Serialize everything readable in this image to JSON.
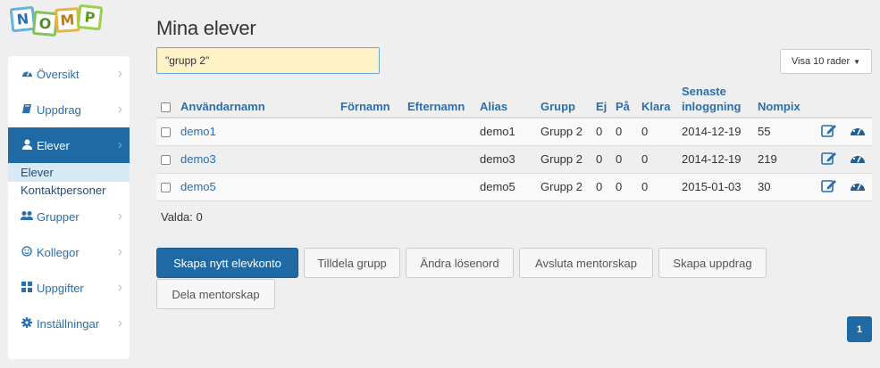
{
  "logo": {
    "letters": [
      "N",
      "O",
      "M",
      "P"
    ]
  },
  "sidebar": {
    "items": [
      {
        "label": "Översikt",
        "icon": "dashboard-icon"
      },
      {
        "label": "Uppdrag",
        "icon": "book-icon"
      },
      {
        "label": "Elever",
        "icon": "user-icon",
        "active": true
      },
      {
        "label": "Grupper",
        "icon": "users-icon"
      },
      {
        "label": "Kollegor",
        "icon": "smile-icon"
      },
      {
        "label": "Uppgifter",
        "icon": "grid-icon"
      },
      {
        "label": "Inställningar",
        "icon": "gear-icon"
      }
    ],
    "sub_items": [
      {
        "label": "Elever",
        "active": true
      },
      {
        "label": "Kontaktpersoner"
      }
    ]
  },
  "page": {
    "title": "Mina elever",
    "search_value": "\"grupp 2\"",
    "rows_select": "Visa 10 rader"
  },
  "table": {
    "headers": {
      "username": "Användarnamn",
      "firstname": "Förnamn",
      "lastname": "Efternamn",
      "alias": "Alias",
      "group": "Grupp",
      "ej": "Ej",
      "pa": "På",
      "klara": "Klara",
      "last_login_1": "Senaste",
      "last_login_2": "inloggning",
      "nompix": "Nompix"
    },
    "rows": [
      {
        "username": "demo1",
        "firstname": "",
        "lastname": "",
        "alias": "demo1",
        "group": "Grupp 2",
        "ej": "0",
        "pa": "0",
        "klara": "0",
        "last_login": "2014-12-19",
        "nompix": "55"
      },
      {
        "username": "demo3",
        "firstname": "",
        "lastname": "",
        "alias": "demo3",
        "group": "Grupp 2",
        "ej": "0",
        "pa": "0",
        "klara": "0",
        "last_login": "2014-12-19",
        "nompix": "219"
      },
      {
        "username": "demo5",
        "firstname": "",
        "lastname": "",
        "alias": "demo5",
        "group": "Grupp 2",
        "ej": "0",
        "pa": "0",
        "klara": "0",
        "last_login": "2015-01-03",
        "nompix": "30"
      }
    ]
  },
  "selected_label": "Valda: 0",
  "buttons": {
    "create": "Skapa nytt elevkonto",
    "assign_group": "Tilldela grupp",
    "change_password": "Ändra lösenord",
    "end_mentorship": "Avsluta mentorskap",
    "create_assignment": "Skapa uppdrag",
    "share_mentorship": "Dela mentorskap"
  },
  "pagination": {
    "current": "1"
  },
  "colors": {
    "primary": "#1f6aa5",
    "link": "#2a6fb0",
    "search_bg": "#fcf1c7"
  }
}
